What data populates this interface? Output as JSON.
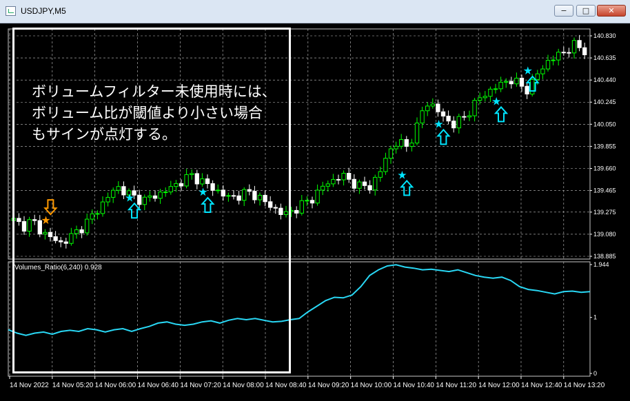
{
  "window": {
    "title": "USDJPY,M5",
    "minimize_label": "−",
    "maximize_label": "□",
    "close_label": "✕"
  },
  "annotation": {
    "text": "ボリュームフィルター未使用時には、\nボリューム比が閾値より小さい場合\nもサインが点灯する。"
  },
  "indicator": {
    "label": "Volumes_Ratio(6,240) 0.928"
  },
  "colors": {
    "bull": "#00ff00",
    "bear": "#ffffff",
    "grid": "#c8c8c8",
    "signal_buy": "#00e5ff",
    "signal_sell": "#ff9900",
    "ratio_line": "#29d8f5"
  },
  "chart_data": [
    {
      "type": "candlestick",
      "symbol": "USDJPY",
      "timeframe": "M5",
      "y_ticks": [
        "140.830",
        "140.635",
        "140.440",
        "140.245",
        "140.050",
        "139.855",
        "139.660",
        "139.465",
        "139.275",
        "139.080",
        "138.885"
      ],
      "ylim": [
        138.885,
        140.83
      ],
      "x_ticks": [
        "14 Nov 2022",
        "14 Nov 05:20",
        "14 Nov 06:00",
        "14 Nov 06:40",
        "14 Nov 07:20",
        "14 Nov 08:00",
        "14 Nov 08:40",
        "14 Nov 09:20",
        "14 Nov 10:00",
        "14 Nov 10:40",
        "14 Nov 11:20",
        "14 Nov 12:00",
        "14 Nov 12:40",
        "14 Nov 13:20"
      ],
      "close_path": [
        139.2,
        139.15,
        139.2,
        139.1,
        139.05,
        139.0,
        139.05,
        139.12,
        139.2,
        139.3,
        139.4,
        139.5,
        139.45,
        139.4,
        139.38,
        139.42,
        139.45,
        139.5,
        139.55,
        139.6,
        139.55,
        139.5,
        139.45,
        139.4,
        139.42,
        139.45,
        139.42,
        139.35,
        139.3,
        139.25,
        139.3,
        139.35,
        139.4,
        139.5,
        139.55,
        139.6,
        139.55,
        139.5,
        139.5,
        139.6,
        139.8,
        139.9,
        139.85,
        140.0,
        140.25,
        140.2,
        140.1,
        140.05,
        140.1,
        140.2,
        140.3,
        140.35,
        140.4,
        140.45,
        140.4,
        140.35,
        140.5,
        140.6,
        140.65,
        140.7,
        140.75,
        140.7
      ],
      "signals": [
        {
          "type": "sell",
          "price": 139.2,
          "index": 6
        },
        {
          "type": "buy",
          "price": 139.4,
          "index": 22
        },
        {
          "type": "buy",
          "price": 139.45,
          "index": 36
        },
        {
          "type": "buy",
          "price": 139.6,
          "index": 74
        },
        {
          "type": "buy",
          "price": 140.05,
          "index": 81
        },
        {
          "type": "buy",
          "price": 140.25,
          "index": 92
        },
        {
          "type": "buy",
          "price": 140.52,
          "index": 98
        }
      ]
    },
    {
      "type": "line",
      "name": "Volumes_Ratio(6,240)",
      "last_value": 0.928,
      "y_ticks": [
        "1.944",
        "1",
        "0"
      ],
      "ylim": [
        0,
        1.944
      ],
      "values": [
        0.78,
        0.72,
        0.68,
        0.72,
        0.74,
        0.7,
        0.75,
        0.77,
        0.75,
        0.8,
        0.78,
        0.74,
        0.78,
        0.8,
        0.75,
        0.8,
        0.84,
        0.9,
        0.92,
        0.88,
        0.86,
        0.88,
        0.92,
        0.94,
        0.9,
        0.95,
        0.98,
        0.96,
        0.98,
        0.95,
        0.92,
        0.93,
        0.96,
        0.98,
        1.1,
        1.2,
        1.3,
        1.36,
        1.35,
        1.4,
        1.55,
        1.75,
        1.85,
        1.92,
        1.94,
        1.9,
        1.88,
        1.85,
        1.86,
        1.84,
        1.82,
        1.85,
        1.8,
        1.75,
        1.72,
        1.7,
        1.72,
        1.66,
        1.55,
        1.5,
        1.48,
        1.45,
        1.42,
        1.46,
        1.47,
        1.45,
        1.46
      ]
    }
  ]
}
